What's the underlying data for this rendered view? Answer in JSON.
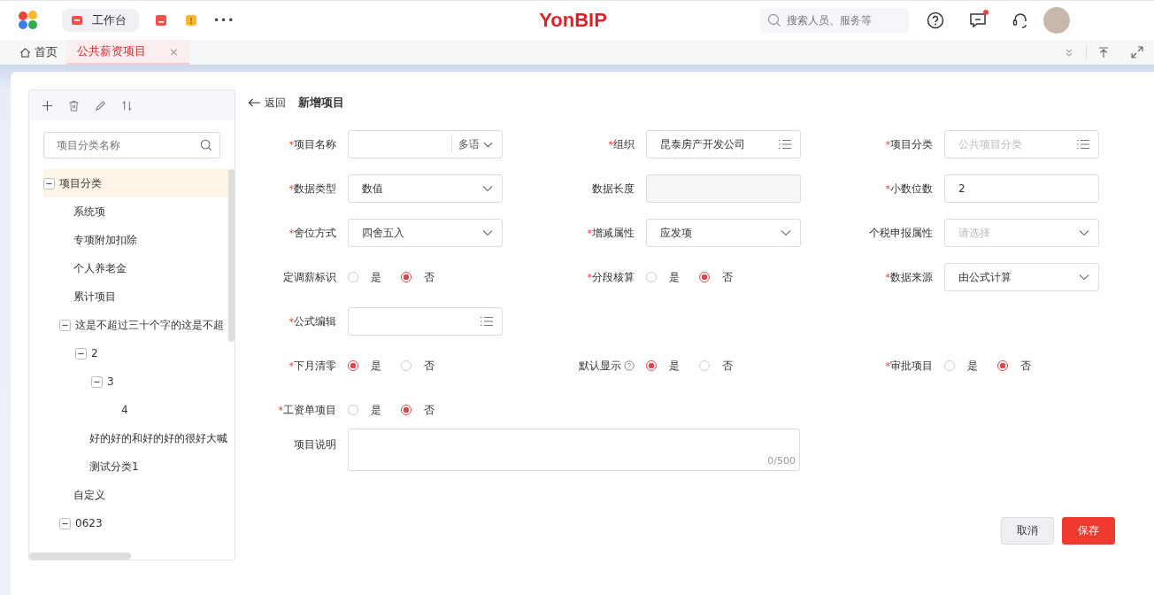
{
  "topbar": {
    "apps": [
      {
        "kind": "label",
        "label": "工作台",
        "selected": true
      },
      {
        "kind": "red",
        "selected": false
      },
      {
        "kind": "yellow",
        "selected": false
      }
    ],
    "more": "•••",
    "brand": "YonBIP",
    "search": {
      "placeholder": "搜索人员、服务等"
    },
    "unread": true
  },
  "tabs": [
    {
      "label": "首页",
      "home": true,
      "closable": false,
      "selected": false
    },
    {
      "label": "公共薪资项目",
      "home": false,
      "closable": true,
      "selected": true,
      "close": "×"
    }
  ],
  "tree_panel": {
    "search": {
      "placeholder": "项目分类名称"
    },
    "tree": [
      {
        "label": "项目分类",
        "expanded": true,
        "selected": true,
        "children": [
          {
            "label": "系统项",
            "selected": false
          },
          {
            "label": "专项附加扣除",
            "selected": false
          },
          {
            "label": "个人养老金",
            "selected": false
          },
          {
            "label": "累计项目",
            "selected": false
          },
          {
            "label": "这是不超过三十个字的这是不超",
            "expanded": true,
            "selected": false,
            "children": [
              {
                "label": "2",
                "expanded": true,
                "selected": false,
                "children": [
                  {
                    "label": "3",
                    "expanded": true,
                    "selected": false,
                    "children": [
                      {
                        "label": "4",
                        "selected": false
                      }
                    ]
                  }
                ]
              },
              {
                "label": "好的好的和好的好的很好大喊",
                "selected": false
              },
              {
                "label": "测试分类1",
                "selected": false
              }
            ]
          },
          {
            "label": "自定义",
            "selected": false
          },
          {
            "label": "0623",
            "expanded": true,
            "selected": false
          }
        ]
      }
    ]
  },
  "form": {
    "back": "返回",
    "title": "新增项目",
    "rows": [
      [
        {
          "kind": "text",
          "label": "项目名称",
          "required": "*",
          "suffix": "多语"
        },
        {
          "kind": "ref",
          "label": "组织",
          "required": "*",
          "value": "昆泰房产开发公司"
        },
        {
          "kind": "ref",
          "label": "项目分类",
          "required": "*",
          "placeholder": "公共项目分类"
        }
      ],
      [
        {
          "kind": "select",
          "label": "数据类型",
          "required": "*",
          "value": "数值"
        },
        {
          "kind": "disabled",
          "label": "数据长度",
          "required": false
        },
        {
          "kind": "text",
          "label": "小数位数",
          "required": "*",
          "value": "2"
        }
      ],
      [
        {
          "kind": "select",
          "label": "舍位方式",
          "required": "*",
          "value": "四舍五入"
        },
        {
          "kind": "select",
          "label": "增减属性",
          "required": "*",
          "value": "应发项"
        },
        {
          "kind": "select",
          "label": "个税申报属性",
          "required": false,
          "placeholder": "请选择"
        }
      ],
      [
        {
          "kind": "radio",
          "label": "定调薪标识",
          "required": false,
          "options": [
            {
              "label": "是",
              "selected": false
            },
            {
              "label": "否",
              "selected": true
            }
          ]
        },
        {
          "kind": "radio",
          "label": "分段核算",
          "required": "*",
          "options": [
            {
              "label": "是",
              "selected": false
            },
            {
              "label": "否",
              "selected": true
            }
          ]
        },
        {
          "kind": "select",
          "label": "数据来源",
          "required": "*",
          "value": "由公式计算"
        }
      ],
      [
        {
          "kind": "ref",
          "label": "公式编辑",
          "required": "*"
        }
      ],
      [
        {
          "kind": "radio",
          "label": "下月清零",
          "required": "*",
          "options": [
            {
              "label": "是",
              "selected": true
            },
            {
              "label": "否",
              "selected": false
            }
          ]
        },
        {
          "kind": "radio",
          "label": "默认显示",
          "required": false,
          "help": true,
          "options": [
            {
              "label": "是",
              "selected": true
            },
            {
              "label": "否",
              "selected": false
            }
          ]
        },
        {
          "kind": "radio",
          "label": "审批项目",
          "required": "*",
          "options": [
            {
              "label": "是",
              "selected": false
            },
            {
              "label": "否",
              "selected": true
            }
          ]
        }
      ],
      [
        {
          "kind": "radio",
          "label": "工资单项目",
          "required": "*",
          "options": [
            {
              "label": "是",
              "selected": false
            },
            {
              "label": "否",
              "selected": true
            }
          ]
        }
      ],
      [
        {
          "kind": "textarea",
          "label": "项目说明",
          "required": false,
          "counter": "0/500"
        }
      ]
    ],
    "buttons": [
      {
        "label": "取消",
        "kind": "secondary"
      },
      {
        "label": "保存",
        "kind": "primary"
      }
    ]
  }
}
